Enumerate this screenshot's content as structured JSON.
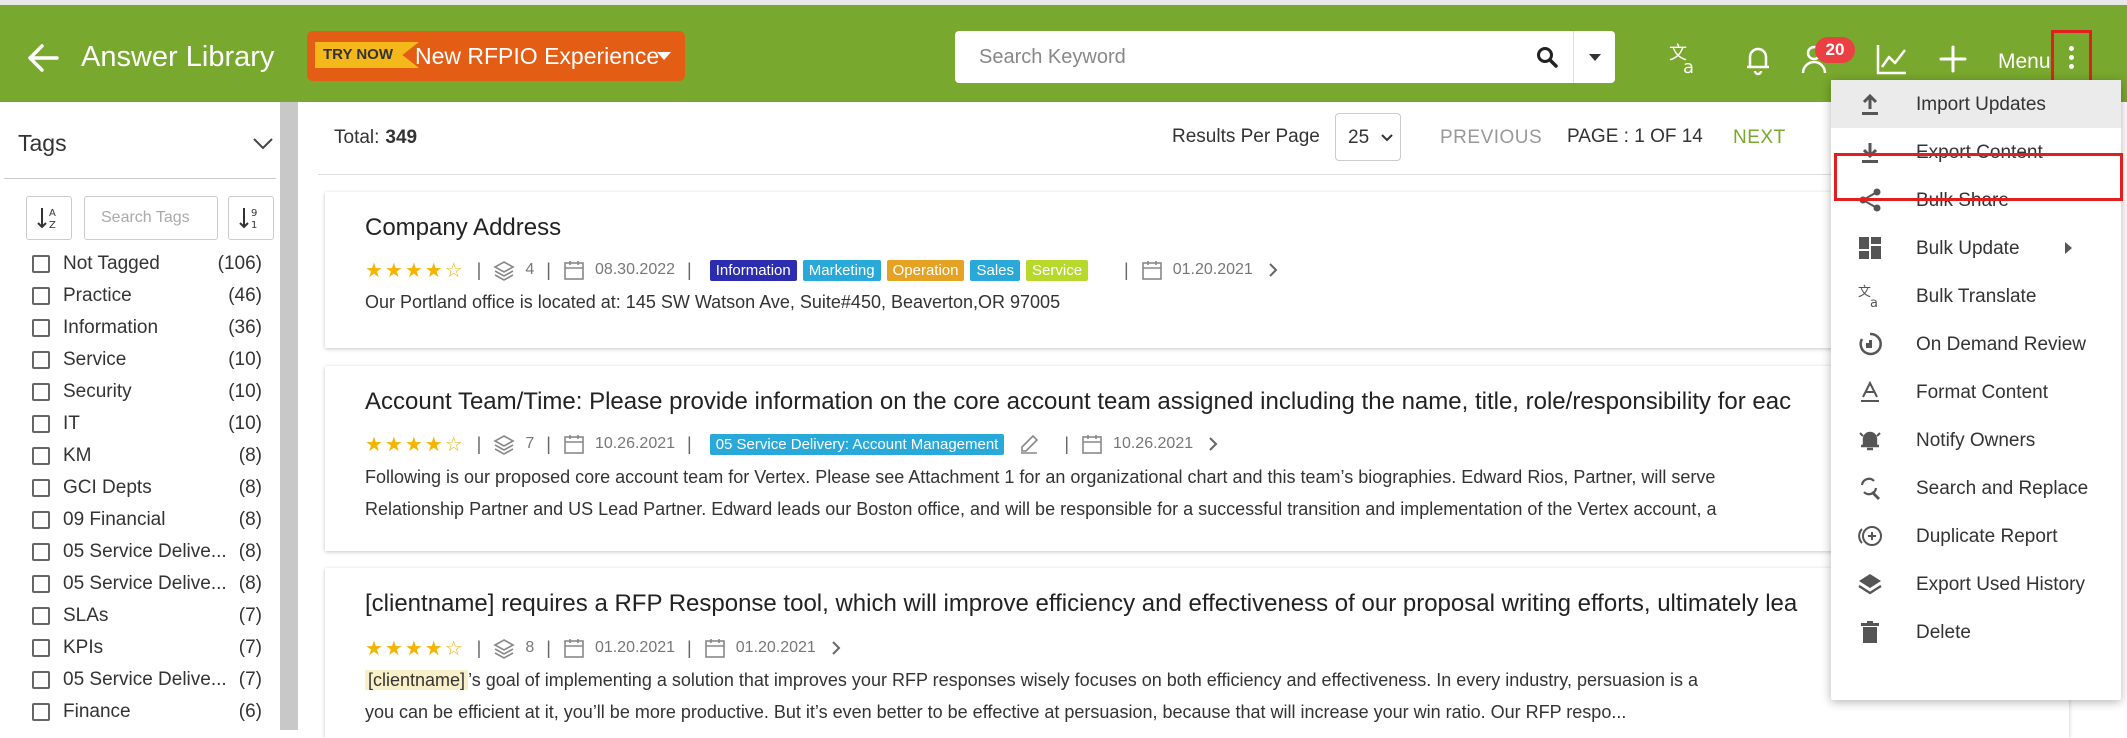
{
  "header": {
    "title": "Answer Library",
    "try_badge": "TRY NOW",
    "try_text": "New RFPIO Experience",
    "search_placeholder": "Search Keyword",
    "notification_count": "20",
    "menu_label": "Menu",
    "icons": [
      "back-arrow-icon",
      "translate-icon",
      "bell-icon",
      "user-icon",
      "chart-line-icon",
      "plus-icon",
      "kebab-icon"
    ],
    "bg_color": "#78a82d",
    "accent_color": "#e45d15"
  },
  "sidebar": {
    "title": "Tags",
    "search_placeholder": "Search Tags",
    "tags": [
      {
        "name": "Not Tagged",
        "count": "(106)"
      },
      {
        "name": "Practice",
        "count": "(46)"
      },
      {
        "name": "Information",
        "count": "(36)"
      },
      {
        "name": "Service",
        "count": "(10)"
      },
      {
        "name": "Security",
        "count": "(10)"
      },
      {
        "name": "IT",
        "count": "(10)"
      },
      {
        "name": "KM",
        "count": "(8)"
      },
      {
        "name": "GCI Depts",
        "count": "(8)"
      },
      {
        "name": "09 Financial",
        "count": "(8)"
      },
      {
        "name": "05 Service Delive...",
        "count": "(8)"
      },
      {
        "name": "05 Service Delive...",
        "count": "(8)"
      },
      {
        "name": "SLAs",
        "count": "(7)"
      },
      {
        "name": "KPIs",
        "count": "(7)"
      },
      {
        "name": "05 Service Delive...",
        "count": "(7)"
      },
      {
        "name": "Finance",
        "count": "(6)"
      }
    ]
  },
  "list": {
    "total_label": "Total:",
    "total_value": "349",
    "rpp_label": "Results Per Page",
    "rpp_value": "25",
    "previous": "PREVIOUS",
    "page_info": "PAGE : 1 OF 14",
    "next": "NEXT"
  },
  "cards": [
    {
      "title": "Company Address",
      "stars": "★★★★☆",
      "count": "4",
      "date1": "08.30.2022",
      "chips": [
        {
          "label": "Information",
          "color": "#2c2cb0"
        },
        {
          "label": "Marketing",
          "color": "#29a9d9"
        },
        {
          "label": "Operation",
          "color": "#e6a323"
        },
        {
          "label": "Sales",
          "color": "#29a9d9"
        },
        {
          "label": "Service",
          "color": "#b7d92c"
        }
      ],
      "date2": "01.20.2021",
      "text1": "Our Portland office is located at: 145 SW Watson Ave, Suite#450, Beaverton,OR 97005"
    },
    {
      "title": "Account Team/Time: Please provide information on the core account team assigned including the name, title, role/responsibility for eac",
      "stars": "★★★★☆",
      "count": "7",
      "date1": "10.26.2021",
      "chips": [
        {
          "label": "05 Service Delivery: Account Management",
          "color": "#29a9d9"
        }
      ],
      "date2": "10.26.2021",
      "text1": "Following is our proposed core account team for Vertex. Please see Attachment 1 for an organizational chart and this team’s biographies. Edward Rios, Partner, will serve",
      "text2": "Relationship Partner and US Lead Partner. Edward leads our Boston office, and will be responsible for a successful transition and implementation of the Vertex account, a"
    },
    {
      "title": "[clientname] requires a RFP Response tool, which will improve efficiency and effectiveness of our proposal writing efforts, ultimately lea",
      "stars": "★★★★☆",
      "count": "8",
      "date1": "01.20.2021",
      "date2": "01.20.2021",
      "highlight": "[clientname]",
      "text1": "’s goal of implementing a solution that improves your RFP responses wisely focuses on both efficiency and effectiveness. In every industry, persuasion is a",
      "text2": "you can be efficient at it, you’ll be more productive. But it’s even better to be effective at persuasion, because that will increase your win ratio. Our RFP respo..."
    }
  ],
  "menu": {
    "items": [
      {
        "label": "Import Updates",
        "icon": "upload-icon"
      },
      {
        "label": "Export Content",
        "icon": "download-icon"
      },
      {
        "label": "Bulk Share",
        "icon": "share-icon"
      },
      {
        "label": "Bulk Update",
        "icon": "dashboard-icon"
      },
      {
        "label": "Bulk Translate",
        "icon": "translate-icon"
      },
      {
        "label": "On Demand Review",
        "icon": "review-icon"
      },
      {
        "label": "Format Content",
        "icon": "format-icon"
      },
      {
        "label": "Notify Owners",
        "icon": "alarm-icon"
      },
      {
        "label": "Search and Replace",
        "icon": "search-replace-icon"
      },
      {
        "label": "Duplicate Report",
        "icon": "duplicate-icon"
      },
      {
        "label": "Export Used History",
        "icon": "layers-icon"
      },
      {
        "label": "Delete",
        "icon": "trash-icon"
      }
    ]
  }
}
